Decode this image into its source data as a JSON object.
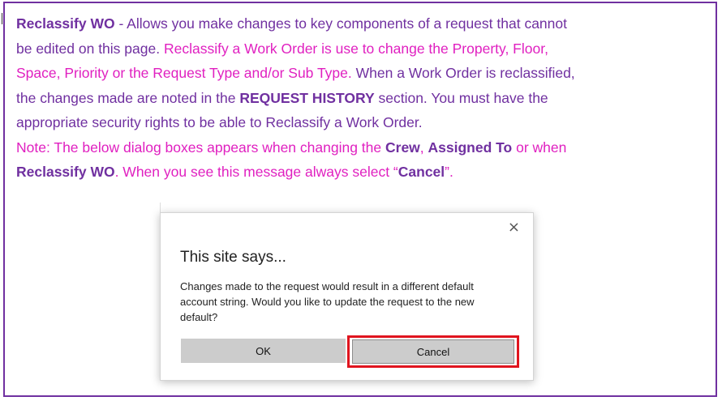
{
  "doc": {
    "line1_bold": "Reclassify WO",
    "line1_rest": " - Allows you make changes to key components of a request that cannot",
    "line2_purple": "be edited on this page. ",
    "line2_pink": "Reclassify a Work Order is use to change the Property, Floor,",
    "line3_pink": "Space, Priority or the Request Type and/or Sub Type.",
    "line3_purple": " When a Work Order is reclassified,",
    "line4_a": "the changes made are noted in the ",
    "line4_bold": "REQUEST HISTORY",
    "line4_b": " section. You must have the",
    "line5": "appropriate security rights to be able to Reclassify a Work Order.",
    "note_a": "Note: The below dialog boxes appears when changing the ",
    "note_crew": "Crew",
    "note_sep": ", ",
    "note_assigned": "Assigned To",
    "note_or": " or when",
    "note_reclassify": "Reclassify WO",
    "note_b": ". When you see this message always select “",
    "note_cancel": "Cancel",
    "note_end": "”."
  },
  "dialog": {
    "close_glyph": "×",
    "title": "This site says...",
    "message": "Changes made to the request would result in a different default account string. Would you like to update the request to the new default?",
    "ok_label": "OK",
    "cancel_label": "Cancel"
  },
  "colors": {
    "border": "#7030a0",
    "purple_text": "#7030a0",
    "pink_text": "#e020c0",
    "highlight": "#e0141e"
  },
  "icons": [
    "close-icon"
  ]
}
